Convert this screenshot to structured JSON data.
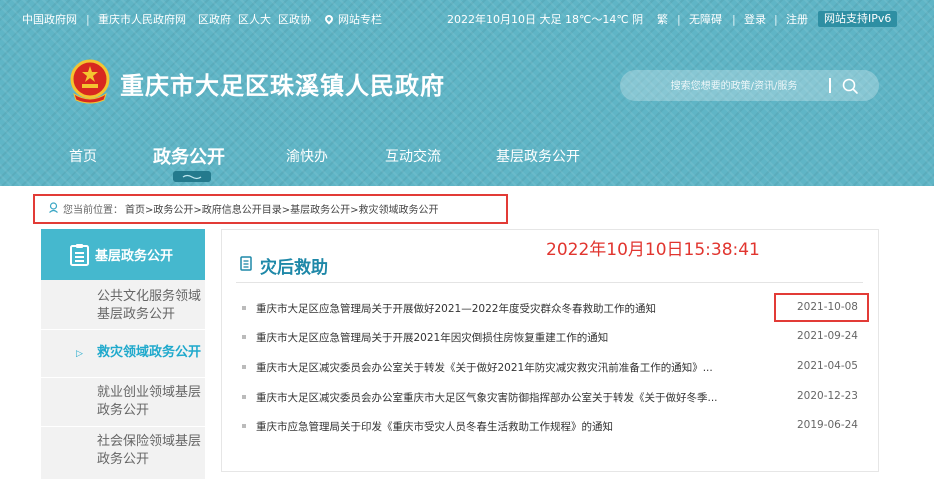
{
  "topbar": {
    "link1": "中国政府网",
    "link2": "重庆市人民政府网",
    "link3": "区政府",
    "link4": "区人大",
    "link5": "区政协",
    "column": "网站专栏",
    "date_weather": "2022年10月10日  大足  18℃～14℃  阴",
    "traditional": "繁",
    "accessible": "无障碍",
    "login": "登录",
    "register": "注册",
    "ipv6": "网站支持IPv6"
  },
  "header": {
    "site_title": "重庆市大足区珠溪镇人民政府",
    "search_placeholder": "搜索您想要的政策/资讯/服务"
  },
  "nav": {
    "items": [
      "首页",
      "政务公开",
      "渝快办",
      "互动交流",
      "基层政务公开"
    ],
    "active_index": 1
  },
  "breadcrumb": {
    "label": "您当前位置：",
    "path": "首页>政务公开>政府信息公开目录>基层政务公开>救灾领域政务公开"
  },
  "sidebar": {
    "title": "基层政务公开",
    "items": [
      "公共文化服务领域基层政务公开",
      "救灾领域政务公开",
      "就业创业领域基层政务公开",
      "社会保险领域基层政务公开"
    ],
    "active_index": 1
  },
  "content": {
    "title": "灾后救助",
    "timestamp": "2022年10月10日15:38:41",
    "articles": [
      {
        "title": "重庆市大足区应急管理局关于开展做好2021—2022年度受灾群众冬春救助工作的通知",
        "date": "2021-10-08"
      },
      {
        "title": "重庆市大足区应急管理局关于开展2021年因灾倒损住房恢复重建工作的通知",
        "date": "2021-09-24"
      },
      {
        "title": "重庆市大足区减灾委员会办公室关于转发《关于做好2021年防灾减灾救灾汛前准备工作的通知》...",
        "date": "2021-04-05"
      },
      {
        "title": "重庆市大足区减灾委员会办公室重庆市大足区气象灾害防御指挥部办公室关于转发《关于做好冬季...",
        "date": "2020-12-23"
      },
      {
        "title": "重庆市应急管理局关于印发《重庆市受灾人员冬春生活救助工作规程》的通知",
        "date": "2019-06-24"
      }
    ]
  },
  "colors": {
    "header_bg": "#5fb5c6",
    "accent": "#1fa9cc",
    "highlight_red": "#e23b36"
  }
}
